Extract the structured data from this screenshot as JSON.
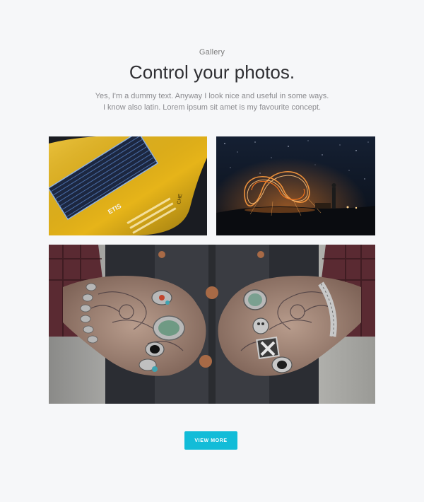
{
  "header": {
    "eyebrow": "Gallery",
    "title": "Control your photos.",
    "description_lines": [
      "Yes, I'm a dummy text. Anyway I look nice and useful in some ways.",
      "I know also latin. Lorem ipsum sit amet is my favourite concept."
    ]
  },
  "gallery": {
    "car_badge": "ETIS",
    "car_script": "CHE"
  },
  "actions": {
    "view_more_label": "VIEW MORE"
  },
  "colors": {
    "background": "#f6f7f9",
    "button": "#12bcd8",
    "car_yellow": "#e8b61a"
  }
}
